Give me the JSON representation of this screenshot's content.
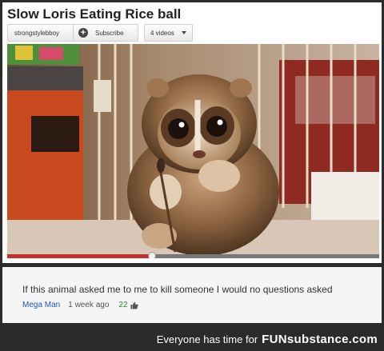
{
  "video": {
    "title": "Slow Loris Eating Rice ball",
    "progress_fraction": 0.39
  },
  "owner": {
    "channel_name": "strongstylebboy",
    "subscribe_label": "Subscribe",
    "videos_label": "4 videos"
  },
  "comment": {
    "text": "If this animal asked me to me to kill someone I would no questions asked",
    "author": "Mega Man",
    "time": "1 week ago",
    "likes": "22"
  },
  "footer": {
    "tagline": "Everyone has time for",
    "brand": "FUNsubstance.com"
  },
  "colors": {
    "progress_played": "#c4302b",
    "author_link": "#1a56c9",
    "like_count": "#2a8d2a"
  },
  "icons": {
    "subscribe": "plus-icon",
    "videos_dropdown": "chevron-down-icon",
    "like": "thumbs-up-icon"
  }
}
